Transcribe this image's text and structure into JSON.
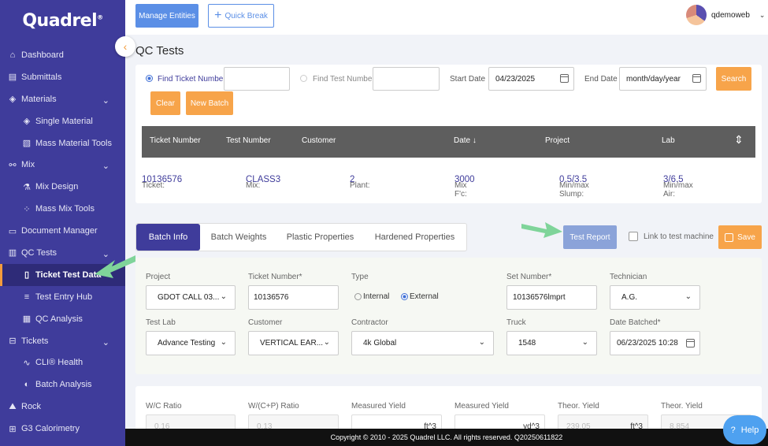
{
  "brand": {
    "logo": "Quadrel",
    "reg": "®"
  },
  "sidebar": {
    "items": [
      {
        "label": "Dashboard",
        "icon": "home-icon"
      },
      {
        "label": "Submittals",
        "icon": "document-icon"
      },
      {
        "label": "Materials",
        "icon": "layers-icon",
        "expanded": true
      },
      {
        "label": "Single Material",
        "icon": "layers-icon",
        "sub": true
      },
      {
        "label": "Mass Material Tools",
        "icon": "tools-icon",
        "sub": true
      },
      {
        "label": "Mix",
        "icon": "mix-icon",
        "expanded": true
      },
      {
        "label": "Mix Design",
        "icon": "flask-icon",
        "sub": true
      },
      {
        "label": "Mass Mix Tools",
        "icon": "grid-icon",
        "sub": true
      },
      {
        "label": "Document Manager",
        "icon": "folder-icon"
      },
      {
        "label": "QC Tests",
        "icon": "clipboard-icon",
        "expanded": true
      },
      {
        "label": "Ticket Test Data",
        "icon": "cylinder-icon",
        "sub": true,
        "active": true
      },
      {
        "label": "Test Entry Hub",
        "icon": "list-icon",
        "sub": true
      },
      {
        "label": "QC Analysis",
        "icon": "chart-icon",
        "sub": true
      },
      {
        "label": "Tickets",
        "icon": "ticket-icon",
        "expanded": true
      },
      {
        "label": "CLI® Health",
        "icon": "pulse-icon",
        "sub": true
      },
      {
        "label": "Batch Analysis",
        "icon": "analysis-icon",
        "sub": true
      },
      {
        "label": "Rock",
        "icon": "rock-icon"
      },
      {
        "label": "G3 Calorimetry",
        "icon": "calorimetry-icon"
      }
    ]
  },
  "topbar": {
    "manage_entities": "Manage Entities",
    "quick_break": "Quick Break",
    "user": "qdemoweb"
  },
  "page": {
    "title": "QC Tests"
  },
  "search": {
    "find_ticket_label": "Find Ticket Number",
    "find_test_label": "Find Test Number",
    "start_date_label": "Start Date",
    "start_date_value": "04/23/2025",
    "end_date_label": "End Date",
    "end_date_value": "month/day/year",
    "search_btn": "Search",
    "clear_btn": "Clear",
    "new_batch_btn": "New Batch"
  },
  "table": {
    "headers": [
      "Ticket Number",
      "Test Number",
      "Customer",
      "Date ↓",
      "Project",
      "Lab"
    ],
    "row": {
      "ticket_lbl": "Ticket:",
      "ticket": "10136576",
      "mix_lbl": "Mix:",
      "mix": "CLASS3",
      "plant_lbl": "Plant:",
      "plant": "2",
      "fc_lbl": "Mix F'c:",
      "fc": "3000",
      "slump_lbl": "Min/max Slump:",
      "slump": "0.5/3.5",
      "air_lbl": "Min/max Air:",
      "air": "3/6.5"
    }
  },
  "tabs": [
    "Batch Info",
    "Batch Weights",
    "Plastic Properties",
    "Hardened Properties"
  ],
  "actions": {
    "test_report": "Test Report",
    "link_machine": "Link to test machine",
    "save": "Save"
  },
  "form": {
    "project_lbl": "Project",
    "project": "GDOT CALL 03...",
    "ticket_lbl": "Ticket Number*",
    "ticket": "10136576",
    "type_lbl": "Type",
    "internal": "Internal",
    "external": "External",
    "set_lbl": "Set Number*",
    "set": "10136576lmprt",
    "tech_lbl": "Technician",
    "tech": "A.G.",
    "lab_lbl": "Test Lab",
    "lab": "Advance Testing",
    "customer_lbl": "Customer",
    "customer": "VERTICAL EAR...",
    "contractor_lbl": "Contractor",
    "contractor": "4k Global",
    "truck_lbl": "Truck",
    "truck": "1548",
    "date_batched_lbl": "Date Batched*",
    "date_batched": "06/23/2025 10:28"
  },
  "ratios": {
    "wc_lbl": "W/C Ratio",
    "wc": "0.16",
    "wcp_lbl": "W/(C+P) Ratio",
    "wcp": "0.13",
    "my1_lbl": "Measured Yield",
    "my1_unit": "ft^3",
    "my2_lbl": "Measured Yield",
    "my2_unit": "yd^3",
    "ty1_lbl": "Theor. Yield",
    "ty1": "239.05",
    "ty1_unit": "ft^3",
    "ty2_lbl": "Theor. Yield",
    "ty2": "8.854"
  },
  "footer": {
    "text": "Copyright © 2010 - 2025 Quadrel LLC. All rights reserved. Q20250611822"
  },
  "help": {
    "label": "Help"
  },
  "colors": {
    "sidebar": "#3f3c9b",
    "accent": "#f7a44a",
    "primary": "#5b8fe6"
  }
}
